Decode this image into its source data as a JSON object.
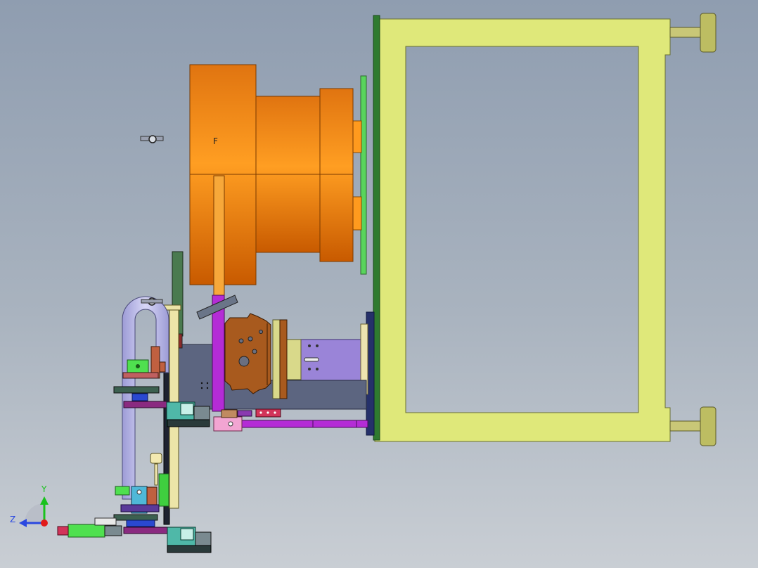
{
  "triad": {
    "y_label": "Y",
    "z_label": "Z"
  },
  "part_label": "F",
  "colors": {
    "frame": "#dfe87a",
    "frame_edge": "#6a7030",
    "platen": "#2f7a2f",
    "mold_strip": "#59d45d",
    "drum": "#ff9a1e",
    "drum_dark": "#c85f00",
    "purple": "#9a84d8",
    "magenta": "#b42cd6",
    "slate": "#5c6580",
    "navy": "#25306a",
    "rust": "#a85a1e",
    "rail": "#c3c2ee",
    "olive": "#d8d88a",
    "pink": "#f2a5d2",
    "teal": "#4fb8a8",
    "bright_green": "#4fe04f",
    "axis_y": "#19c21d",
    "axis_z": "#2a48e0",
    "axis_origin": "#e01a1a"
  }
}
